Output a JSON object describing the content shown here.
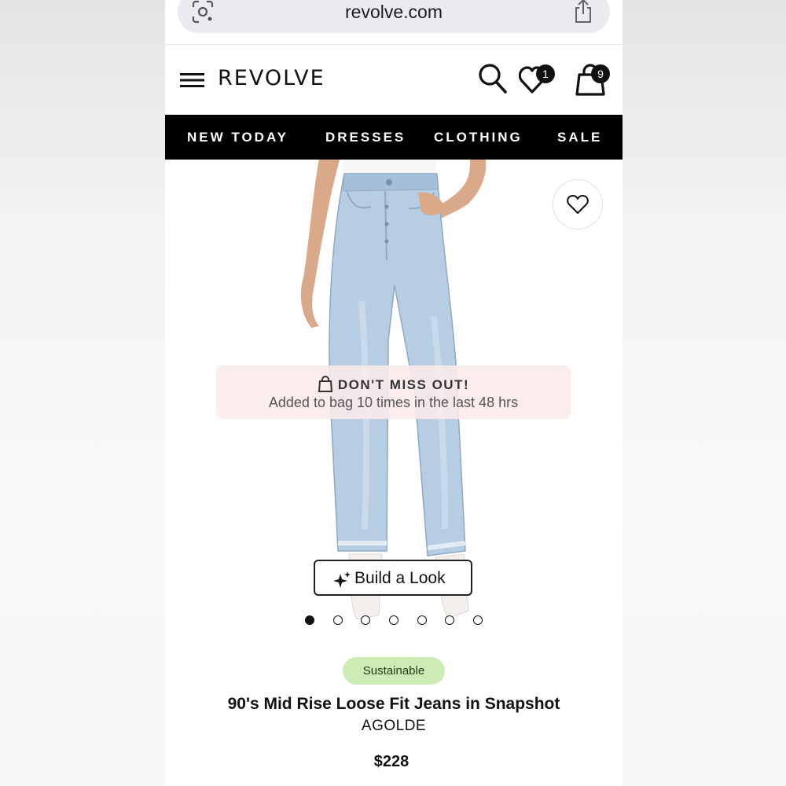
{
  "browser": {
    "url": "revolve.com",
    "icons": {
      "left": "google-lens-icon",
      "right": "share-icon"
    }
  },
  "header": {
    "logo": "REVOLVE",
    "wishlist_count": "1",
    "bag_count": "9",
    "icons": [
      "menu-icon",
      "search-icon",
      "heart-icon",
      "bag-icon"
    ]
  },
  "nav": {
    "categories": [
      "NEW TODAY",
      "DRESSES",
      "CLOTHING",
      "SALE"
    ]
  },
  "product_gallery": {
    "promo_title": "DON'T MISS OUT!",
    "promo_text": "Added to bag 10 times in the last 48 hrs",
    "build_look_label": "Build a Look",
    "image_count": 7,
    "active_image": 1
  },
  "product": {
    "badge": "Sustainable",
    "title": "90's Mid Rise Loose Fit Jeans in Snapshot",
    "brand": "AGOLDE",
    "price": "$228"
  },
  "colors": {
    "nav_bg": "#000000",
    "promo_bg": "#fcebea",
    "tag_bg": "#cdebb5",
    "denim": "#b6cde2"
  }
}
